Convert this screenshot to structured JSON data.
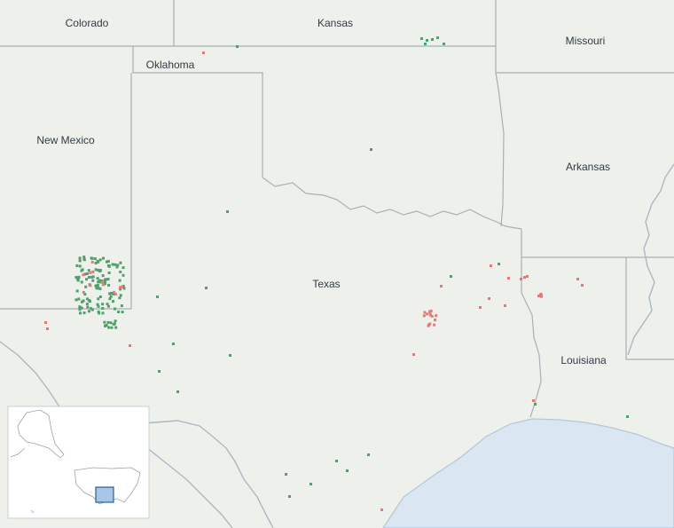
{
  "map": {
    "state_labels": [
      {
        "id": "colorado",
        "text": "Colorado"
      },
      {
        "id": "kansas",
        "text": "Kansas"
      },
      {
        "id": "missouri",
        "text": "Missouri"
      },
      {
        "id": "oklahoma",
        "text": "Oklahoma"
      },
      {
        "id": "new-mexico",
        "text": "New Mexico"
      },
      {
        "id": "arkansas",
        "text": "Arkansas"
      },
      {
        "id": "texas",
        "text": "Texas"
      },
      {
        "id": "louisiana",
        "text": "Louisiana"
      }
    ],
    "colors": {
      "background": "#eef0eb",
      "water": "#dae6f1",
      "border": "#a9b0b5",
      "marker_green": "#4fa06b",
      "marker_red": "#e07b79",
      "inset_highlight": "#a9c6e8"
    },
    "marker_categories": [
      "green",
      "red"
    ],
    "inset": {
      "view": "United States overview",
      "highlighted_region": "Texas and surrounding states"
    }
  }
}
